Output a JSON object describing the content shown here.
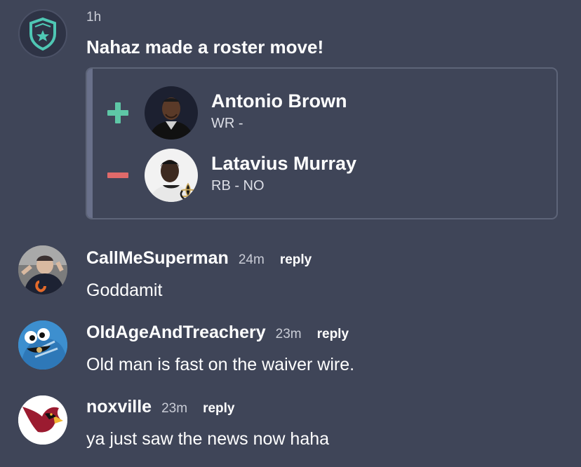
{
  "post": {
    "time": "1h",
    "title": "Nahaz made a roster move!",
    "moves": [
      {
        "type": "add",
        "name": "Antonio Brown",
        "position": "WR -"
      },
      {
        "type": "drop",
        "name": "Latavius Murray",
        "position": "RB - NO"
      }
    ]
  },
  "comments": [
    {
      "author": "CallMeSuperman",
      "time": "24m",
      "reply_label": "reply",
      "text": "Goddamit"
    },
    {
      "author": "OldAgeAndTreachery",
      "time": "23m",
      "reply_label": "reply",
      "text": "Old man is fast on the waiver wire."
    },
    {
      "author": "noxville",
      "time": "23m",
      "reply_label": "reply",
      "text": "ya just saw the news now haha"
    }
  ],
  "colors": {
    "background": "#3f4558",
    "add": "#5ec7a6",
    "drop": "#e06a6a",
    "badge": "#4fc7b4"
  }
}
